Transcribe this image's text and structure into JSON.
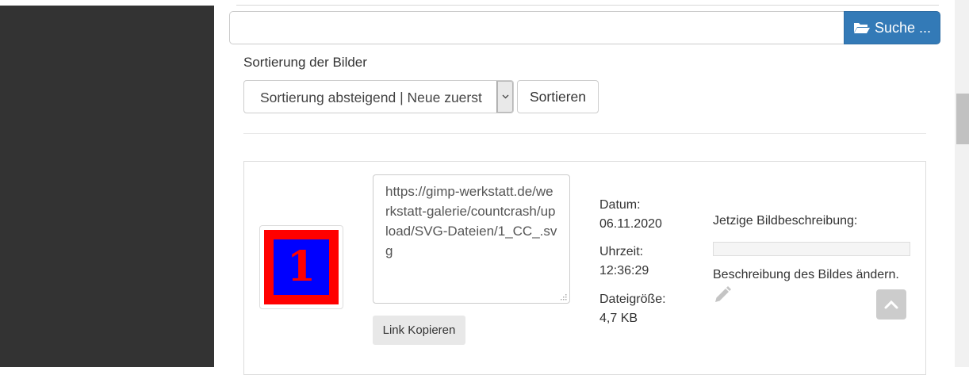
{
  "search": {
    "value": "",
    "button_label": "Suche ...",
    "button_icon": "folder-open-icon",
    "button_color": "#337ab7"
  },
  "sort": {
    "heading": "Sortierung der Bilder",
    "selected_option": "Sortierung absteigend | Neue zuerst",
    "button_label": "Sortieren"
  },
  "image": {
    "thumbnail_text": "1",
    "thumbnail_outer_color": "#ff0000",
    "thumbnail_inner_color": "#0000ff",
    "url": "https://gimp-werkstatt.de/werkstatt-galerie/countcrash/upload/SVG-Dateien/1_CC_.svg",
    "copy_label": "Link Kopieren",
    "date_label": "Datum:",
    "date_value": "06.11.2020",
    "time_label": "Uhrzeit:",
    "time_value": "12:36:29",
    "size_label": "Dateigröße:",
    "size_value": "4,7 KB",
    "description_label": "Jetzige Bildbeschreibung:",
    "description_value": "",
    "change_description_label": "Beschreibung des Bildes ändern."
  },
  "icons": {
    "edit": "pencil-icon",
    "back_to_top": "chevron-up-icon",
    "sort_dropdown": "chevron-down-icon"
  }
}
